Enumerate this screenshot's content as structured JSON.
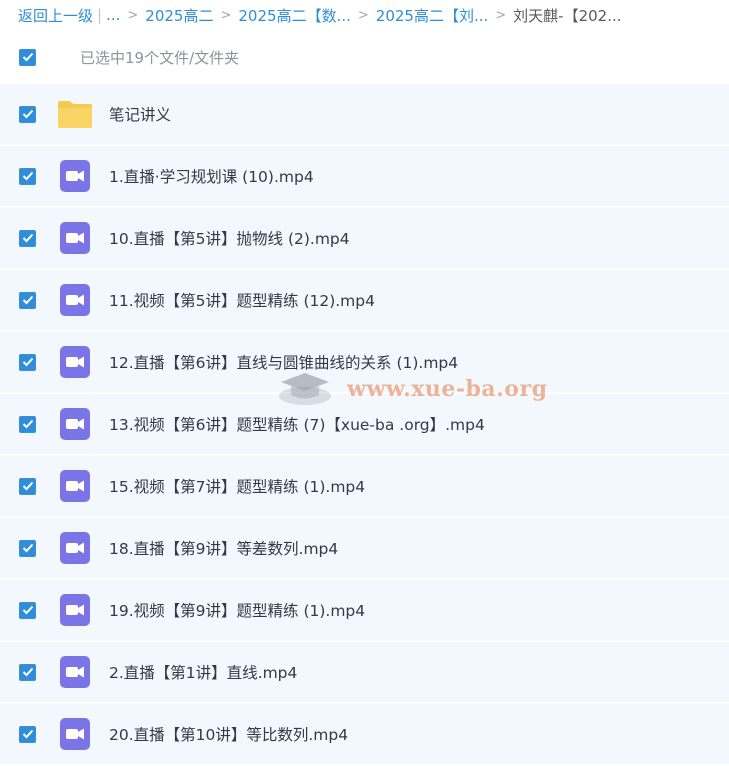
{
  "breadcrumb": {
    "back": "返回上一级",
    "ellipsis": "...",
    "items": [
      "2025高二",
      "2025高二【数...",
      "2025高二【刘...",
      "刘天麒-【202..."
    ]
  },
  "selection": {
    "label": "已选中19个文件/文件夹"
  },
  "files": [
    {
      "name": "笔记讲义",
      "type": "folder"
    },
    {
      "name": "1.直播·学习规划课 (10).mp4",
      "type": "video"
    },
    {
      "name": "10.直播【第5讲】抛物线 (2).mp4",
      "type": "video"
    },
    {
      "name": "11.视频【第5讲】题型精练 (12).mp4",
      "type": "video"
    },
    {
      "name": "12.直播【第6讲】直线与圆锥曲线的关系 (1).mp4",
      "type": "video"
    },
    {
      "name": "13.视频【第6讲】题型精练 (7)【xue-ba .org】.mp4",
      "type": "video"
    },
    {
      "name": "15.视频【第7讲】题型精练 (1).mp4",
      "type": "video"
    },
    {
      "name": "18.直播【第9讲】等差数列.mp4",
      "type": "video"
    },
    {
      "name": "19.视频【第9讲】题型精练 (1).mp4",
      "type": "video"
    },
    {
      "name": "2.直播【第1讲】直线.mp4",
      "type": "video"
    },
    {
      "name": "20.直播【第10讲】等比数列.mp4",
      "type": "video"
    }
  ],
  "watermark": "www.xue-ba.org",
  "colors": {
    "accent": "#2f8ed8",
    "video_icon": "#7b74e6",
    "folder": "#f6c94f",
    "row_bg": "#f2f8fd"
  }
}
